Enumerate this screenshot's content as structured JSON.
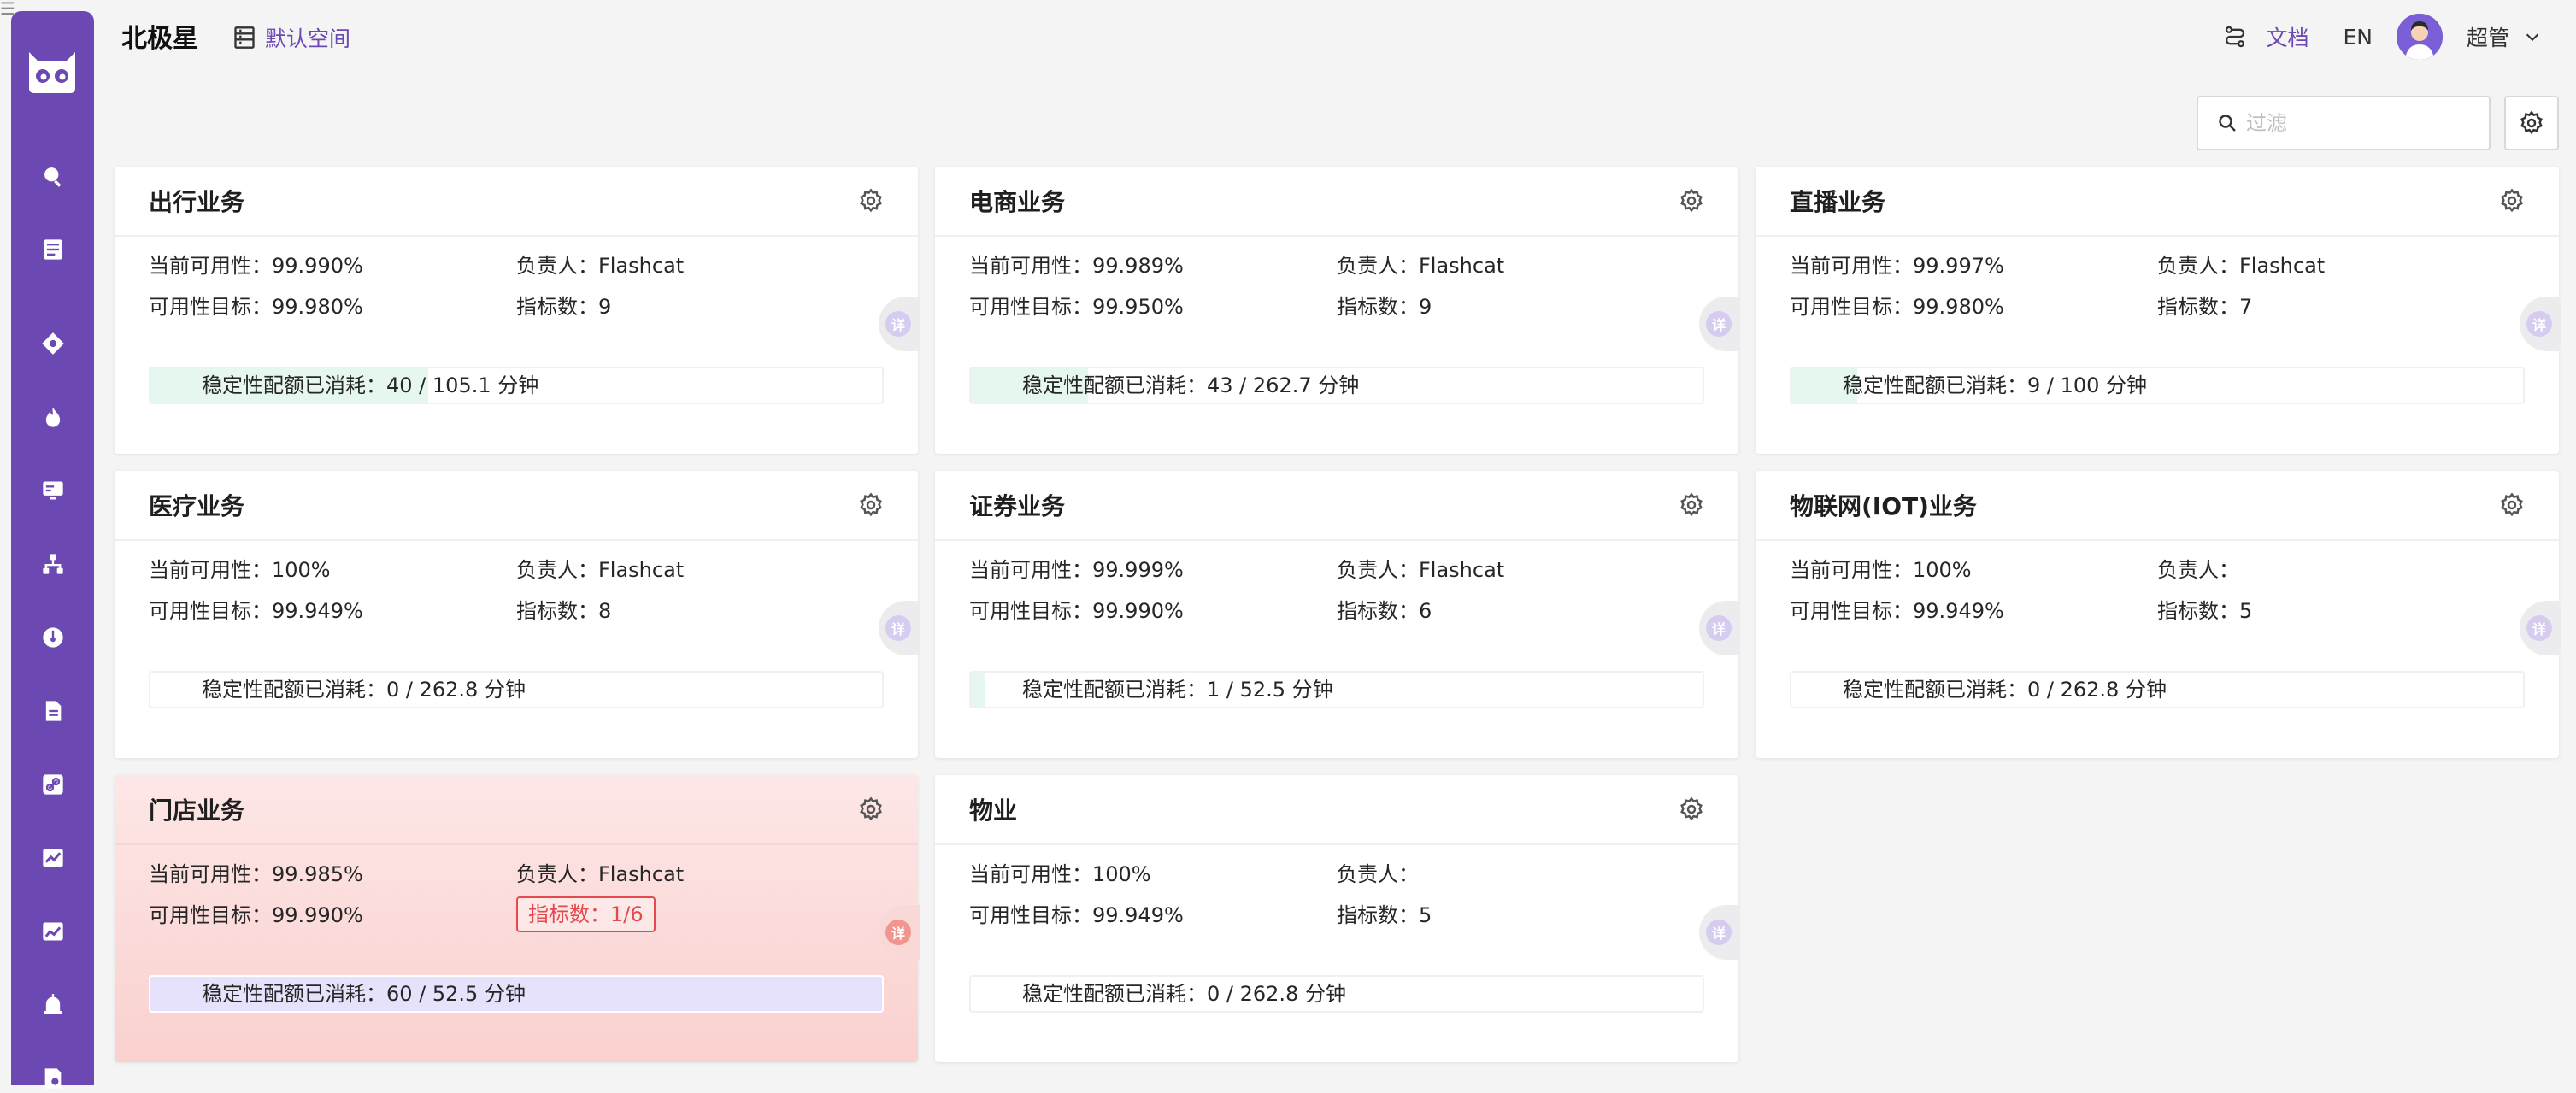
{
  "app": {
    "title": "北极星",
    "workspace": "默认空间"
  },
  "header": {
    "docs": "文档",
    "lang": "EN",
    "user": "超管"
  },
  "filter": {
    "placeholder": "过滤"
  },
  "labels": {
    "current": "当前可用性：",
    "target": "可用性目标：",
    "owner": "负责人：",
    "metrics": "指标数：",
    "quota": "稳定性配额已消耗：",
    "detail": "详"
  },
  "sidebar": {
    "items": [
      {
        "icon": "search-icon"
      },
      {
        "icon": "list-icon"
      },
      {
        "icon": "compass-icon"
      },
      {
        "icon": "fire-icon"
      },
      {
        "icon": "monitor-icon"
      },
      {
        "icon": "topology-icon"
      },
      {
        "icon": "gauge-icon"
      },
      {
        "icon": "document-icon"
      },
      {
        "icon": "link-icon"
      },
      {
        "icon": "trend-chart-icon"
      },
      {
        "icon": "line-chart-icon"
      },
      {
        "icon": "alarm-icon"
      },
      {
        "icon": "settings-document-icon"
      }
    ]
  },
  "cards": [
    {
      "title": "出行业务",
      "current": "99.990%",
      "target": "99.980%",
      "owner": "Flashcat",
      "metrics": "9",
      "quota": "40 / 105.1 分钟",
      "quota_ratio": 0.38,
      "alert": false
    },
    {
      "title": "电商业务",
      "current": "99.989%",
      "target": "99.950%",
      "owner": "Flashcat",
      "metrics": "9",
      "quota": "43 / 262.7 分钟",
      "quota_ratio": 0.16,
      "alert": false
    },
    {
      "title": "直播业务",
      "current": "99.997%",
      "target": "99.980%",
      "owner": "Flashcat",
      "metrics": "7",
      "quota": "9 / 100 分钟",
      "quota_ratio": 0.09,
      "alert": false
    },
    {
      "title": "医疗业务",
      "current": "100%",
      "target": "99.949%",
      "owner": "Flashcat",
      "metrics": "8",
      "quota": "0 / 262.8 分钟",
      "quota_ratio": 0,
      "alert": false
    },
    {
      "title": "证券业务",
      "current": "99.999%",
      "target": "99.990%",
      "owner": "Flashcat",
      "metrics": "6",
      "quota": "1 / 52.5 分钟",
      "quota_ratio": 0.02,
      "alert": false
    },
    {
      "title": "物联网(IOT)业务",
      "current": "100%",
      "target": "99.949%",
      "owner": "",
      "metrics": "5",
      "quota": "0 / 262.8 分钟",
      "quota_ratio": 0,
      "alert": false
    },
    {
      "title": "门店业务",
      "current": "99.985%",
      "target": "99.990%",
      "owner": "Flashcat",
      "metrics": "1/6",
      "quota": "60 / 52.5 分钟",
      "quota_ratio": 1,
      "alert": true
    },
    {
      "title": "物业",
      "current": "100%",
      "target": "99.949%",
      "owner": "",
      "metrics": "5",
      "quota": "0 / 262.8 分钟",
      "quota_ratio": 0,
      "alert": false
    }
  ],
  "colors": {
    "accent": "#6c48b3",
    "quota_ok": "#e6f7ef",
    "quota_over": "#e6e2fb",
    "alert_border": "#e5484d"
  }
}
